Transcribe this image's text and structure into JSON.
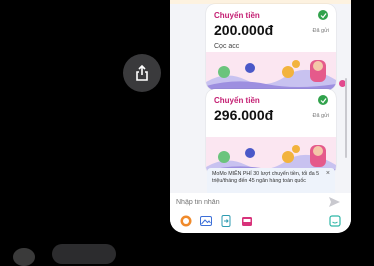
{
  "cards": [
    {
      "title": "Chuyển tiền",
      "amount": "200.000đ",
      "note": "Cọc acc",
      "status": "Đã gửi"
    },
    {
      "title": "Chuyển tiền",
      "amount": "296.000đ",
      "note": "",
      "status": "Đã gửi"
    }
  ],
  "notice": {
    "text": "MoMo MIỄN PHÍ 30 lượt chuyển tiền, tối đa 5 triệu/tháng đến 45 ngân hàng toàn quốc",
    "close": "×"
  },
  "composer": {
    "placeholder": "Nhập tin nhắn"
  },
  "icons": {
    "share": "share-icon",
    "send": "send-icon",
    "toolbar": [
      "money-icon",
      "image-icon",
      "transfer-icon",
      "gift-icon",
      "sticker-icon"
    ]
  },
  "colors": {
    "accent": "#c41e72",
    "check": "#31a24c",
    "background": "#000000"
  }
}
